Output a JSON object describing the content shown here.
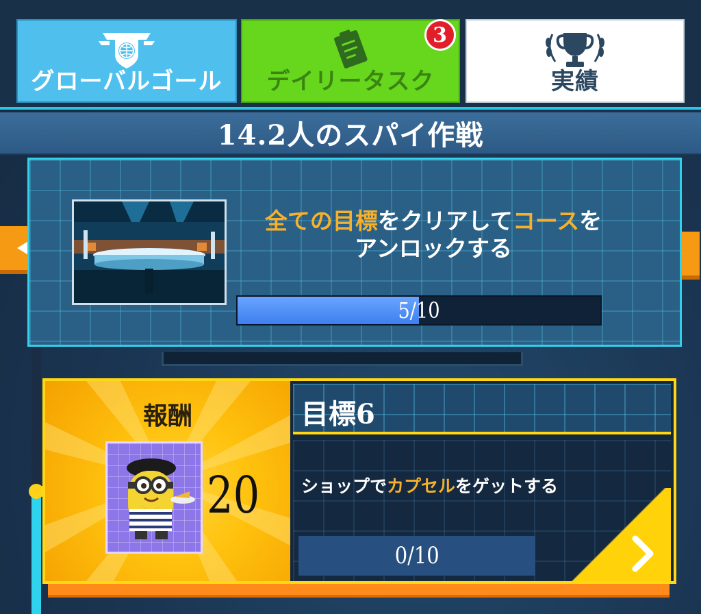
{
  "tabs": {
    "global_label": "グローバルゴール",
    "daily_label": "デイリータスク",
    "daily_badge": "3",
    "achievements_label": "実績"
  },
  "title": "14.2人のスパイ作戦",
  "course": {
    "description_parts": [
      "全ての目標",
      "をクリアして",
      "コース",
      "を"
    ],
    "description_line2": "アンロックする",
    "progress_text": "5/10",
    "progress_value": 0.5
  },
  "goal": {
    "reward_label": "報酬",
    "reward_count": "20",
    "title": "目標6",
    "desc_parts": [
      "ショップで",
      "カプセル",
      "をゲットする"
    ],
    "progress_text": "0/10"
  },
  "colors": {
    "highlight": "#f6b02b",
    "tab_global": "#4fc0ee",
    "tab_daily": "#66d71d",
    "accent_cyan": "#33d0ec",
    "goal_border": "#ffd814"
  }
}
